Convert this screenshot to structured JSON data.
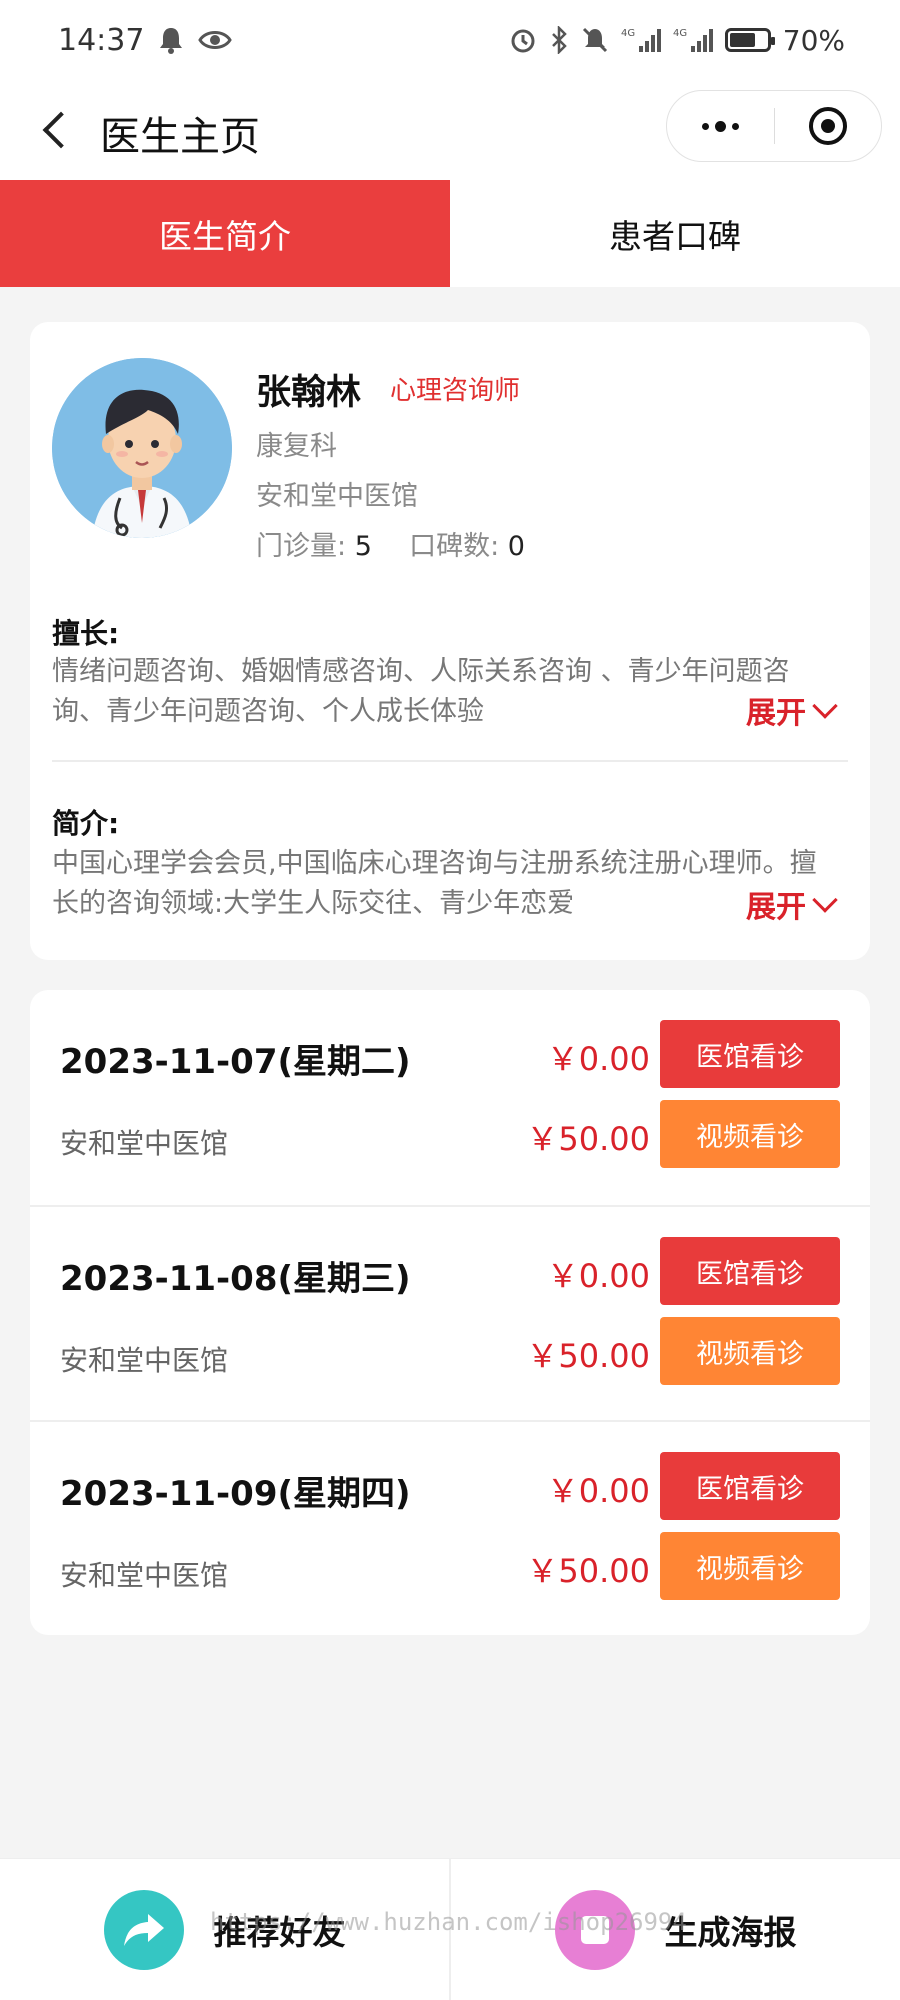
{
  "status_bar": {
    "time": "14:37",
    "battery": "70%",
    "battery_level": 0.7,
    "network_1": "4G",
    "network_2": "4G"
  },
  "nav": {
    "title": "医生主页"
  },
  "tabs": [
    {
      "label": "医生简介",
      "active": true
    },
    {
      "label": "患者口碑",
      "active": false
    }
  ],
  "doctor": {
    "name": "张翰林",
    "title": "心理咨询师",
    "department": "康复科",
    "hospital": "安和堂中医馆",
    "visits_label": "门诊量:",
    "visits_value": "5",
    "reviews_label": "口碑数:",
    "reviews_value": "0"
  },
  "specialty": {
    "heading": "擅长:",
    "text": "情绪问题咨询、婚姻情感咨询、人际关系咨询 、青少年问题咨询、青少年问题咨询、个人成长体验",
    "expand_label": "展开"
  },
  "intro": {
    "heading": "简介:",
    "text": "中国心理学会会员,中国临床心理咨询与注册系统注册心理师。擅长的咨询领域:大学生人际交往、青少年恋爱",
    "expand_label": "展开"
  },
  "schedule": [
    {
      "date": "2023-11-07(星期二)",
      "hospital": "安和堂中医馆",
      "clinic_price": "￥0.00",
      "video_price": "￥50.00",
      "clinic_btn": "医馆看诊",
      "video_btn": "视频看诊"
    },
    {
      "date": "2023-11-08(星期三)",
      "hospital": "安和堂中医馆",
      "clinic_price": "￥0.00",
      "video_price": "￥50.00",
      "clinic_btn": "医馆看诊",
      "video_btn": "视频看诊"
    },
    {
      "date": "2023-11-09(星期四)",
      "hospital": "安和堂中医馆",
      "clinic_price": "￥0.00",
      "video_price": "￥50.00",
      "clinic_btn": "医馆看诊",
      "video_btn": "视频看诊"
    }
  ],
  "bottom": {
    "share_label": "推荐好友",
    "poster_label": "生成海报",
    "watermark": "https://www.huzhan.com/ishop26994"
  },
  "colors": {
    "accent": "#ea3e3e",
    "price": "#d9222a",
    "video_button": "#ff8534"
  }
}
